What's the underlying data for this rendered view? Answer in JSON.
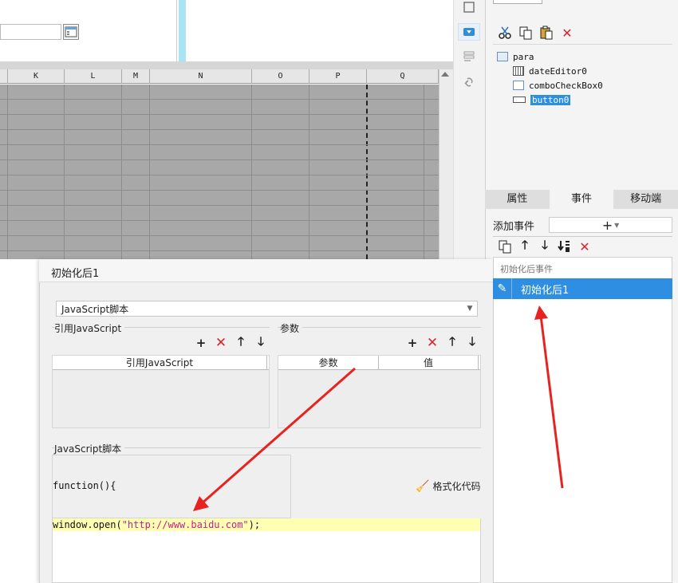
{
  "spreadsheet": {
    "columns": [
      "K",
      "L",
      "M",
      "N",
      "O",
      "P",
      "Q"
    ]
  },
  "tree": {
    "items": [
      {
        "label": "para",
        "icon": "form-icon"
      },
      {
        "label": "dateEditor0",
        "icon": "calendar-icon"
      },
      {
        "label": "comboCheckBox0",
        "icon": "combo-icon"
      },
      {
        "label": "button0",
        "icon": "button-widget-icon",
        "selected": true
      }
    ]
  },
  "tabs": [
    {
      "label": "属性",
      "active": false
    },
    {
      "label": "事件",
      "active": true
    },
    {
      "label": "移动端",
      "active": false
    }
  ],
  "events": {
    "add_label": "添加事件",
    "add_button": "+",
    "header": "初始化后事件",
    "items": [
      {
        "label": "初始化后1",
        "selected": true
      }
    ]
  },
  "dialog": {
    "title": "初始化后1",
    "type_select": "JavaScript脚本",
    "ref_js": {
      "group_title": "引用JavaScript",
      "column_header": "引用JavaScript"
    },
    "params": {
      "group_title": "参数",
      "columns": [
        "参数",
        "值"
      ]
    },
    "script": {
      "group_title": "JavaScript脚本",
      "function_head": "function(){",
      "format_label": "格式化代码",
      "code_prefix": "window.open(",
      "code_string": "\"http://www.baidu.com\"",
      "code_suffix": ");"
    }
  },
  "colors": {
    "accent": "#2d8ee2",
    "delete": "#d9262b",
    "annotation_arrow": "#e8221e",
    "code_highlight": "#ffffb4"
  }
}
